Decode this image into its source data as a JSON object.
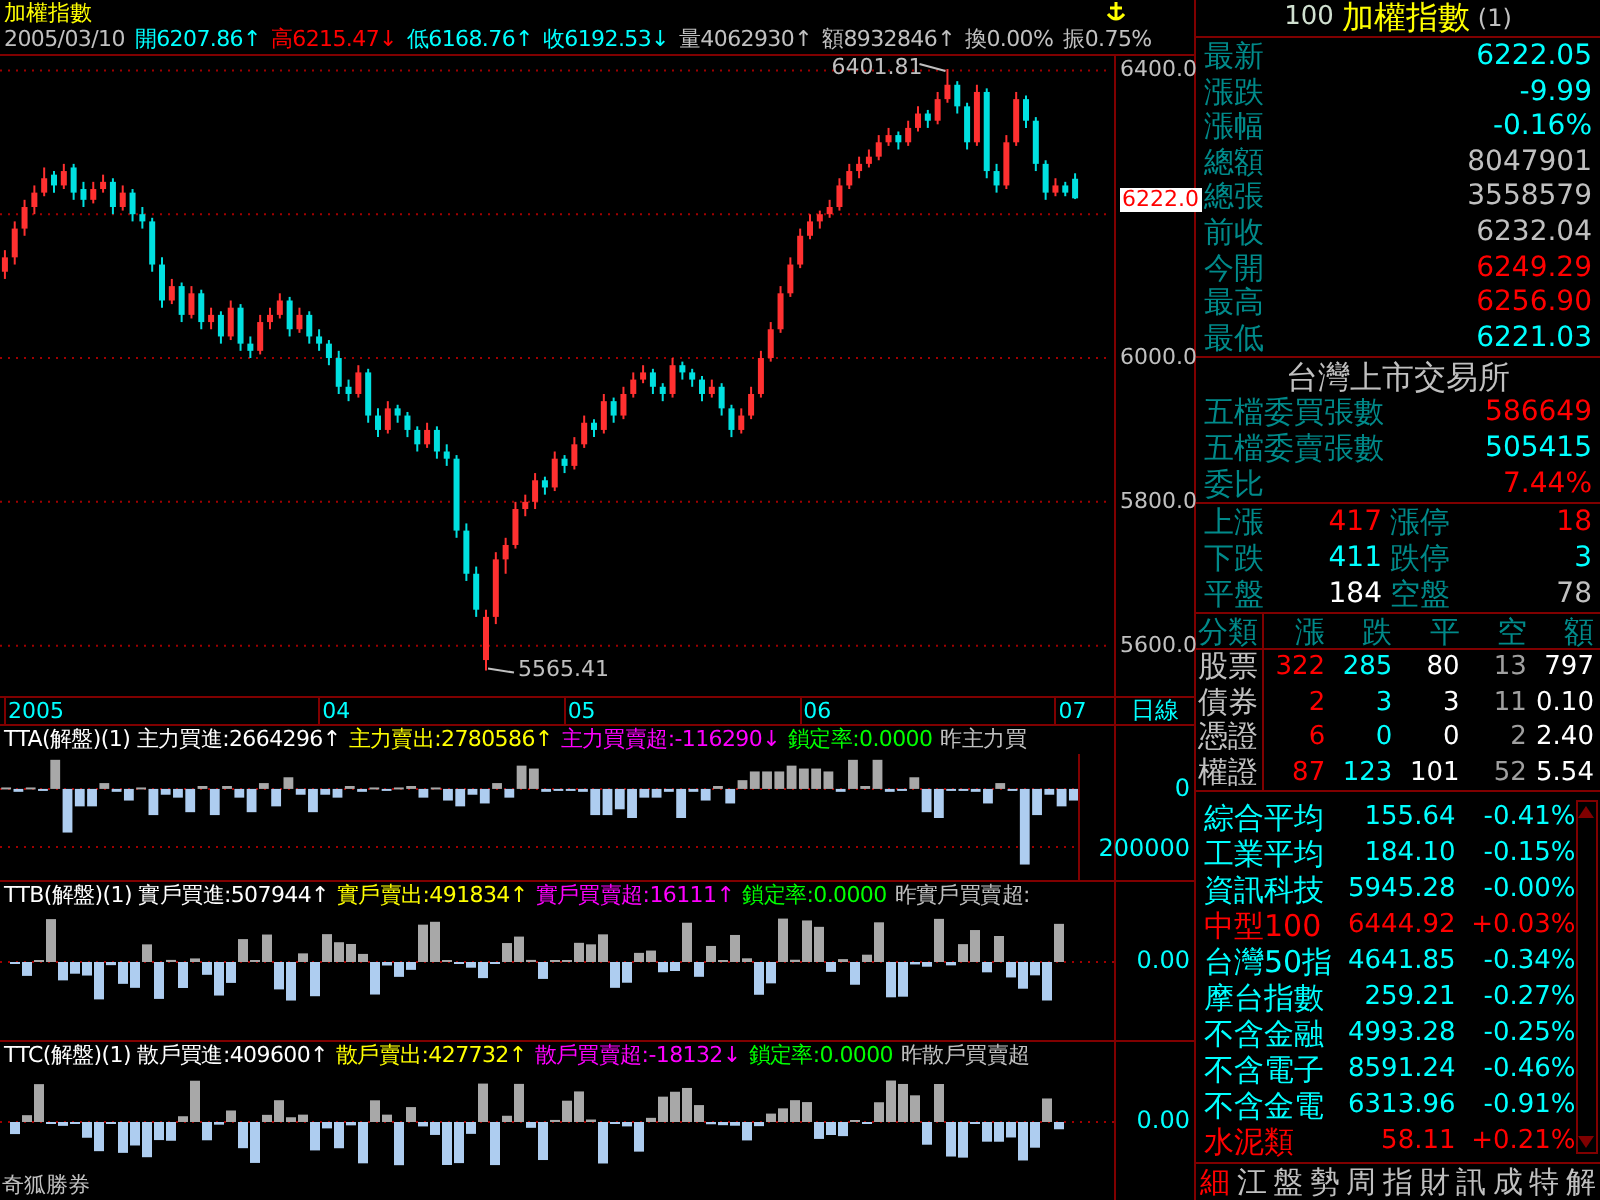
{
  "chart_title": "加權指數",
  "info_bar": {
    "date": "2005/03/10",
    "items": [
      {
        "label": "開",
        "value": "6207.86",
        "arrow": "↑",
        "color": "#00ffff"
      },
      {
        "label": "高",
        "value": "6215.47",
        "arrow": "↓",
        "color": "#ff0000"
      },
      {
        "label": "低",
        "value": "6168.76",
        "arrow": "↑",
        "color": "#00ffff"
      },
      {
        "label": "收",
        "value": "6192.53",
        "arrow": "↓",
        "color": "#00ffff"
      },
      {
        "label": "量",
        "value": "4062930",
        "arrow": "↑",
        "color": "#c0c0c0"
      },
      {
        "label": "額",
        "value": "8932846",
        "arrow": "↑",
        "color": "#c0c0c0"
      },
      {
        "label": "換",
        "value": "0.00%",
        "color": "#c0c0c0"
      },
      {
        "label": "振",
        "value": "0.75%",
        "color": "#c0c0c0"
      }
    ]
  },
  "price_chart": {
    "chart_data": {
      "type": "candlestick",
      "ohlc": [
        [
          6120,
          6150,
          6110,
          6140
        ],
        [
          6140,
          6190,
          6130,
          6180
        ],
        [
          6180,
          6220,
          6170,
          6210
        ],
        [
          6210,
          6240,
          6200,
          6230
        ],
        [
          6230,
          6265,
          6225,
          6250
        ],
        [
          6255,
          6260,
          6230,
          6240
        ],
        [
          6240,
          6270,
          6235,
          6260
        ],
        [
          6265,
          6270,
          6220,
          6230
        ],
        [
          6235,
          6245,
          6210,
          6220
        ],
        [
          6220,
          6245,
          6215,
          6235
        ],
        [
          6235,
          6255,
          6230,
          6245
        ],
        [
          6245,
          6250,
          6200,
          6210
        ],
        [
          6210,
          6240,
          6205,
          6230
        ],
        [
          6230,
          6235,
          6190,
          6200
        ],
        [
          6200,
          6210,
          6180,
          6190
        ],
        [
          6190,
          6195,
          6120,
          6130
        ],
        [
          6130,
          6140,
          6070,
          6080
        ],
        [
          6080,
          6110,
          6075,
          6100
        ],
        [
          6100,
          6105,
          6050,
          6060
        ],
        [
          6060,
          6100,
          6055,
          6090
        ],
        [
          6090,
          6095,
          6040,
          6050
        ],
        [
          6050,
          6070,
          6040,
          6060
        ],
        [
          6060,
          6065,
          6020,
          6030
        ],
        [
          6030,
          6080,
          6025,
          6070
        ],
        [
          6070,
          6075,
          6010,
          6020
        ],
        [
          6020,
          6030,
          6000,
          6010
        ],
        [
          6010,
          6060,
          6005,
          6050
        ],
        [
          6050,
          6070,
          6040,
          6060
        ],
        [
          6060,
          6090,
          6055,
          6080
        ],
        [
          6080,
          6085,
          6030,
          6040
        ],
        [
          6040,
          6070,
          6035,
          6060
        ],
        [
          6060,
          6065,
          6020,
          6030
        ],
        [
          6030,
          6040,
          6010,
          6020
        ],
        [
          6020,
          6025,
          5990,
          6000
        ],
        [
          6000,
          6010,
          5950,
          5960
        ],
        [
          5960,
          5970,
          5940,
          5950
        ],
        [
          5950,
          5990,
          5945,
          5980
        ],
        [
          5980,
          5985,
          5910,
          5920
        ],
        [
          5920,
          5930,
          5890,
          5900
        ],
        [
          5900,
          5940,
          5895,
          5930
        ],
        [
          5930,
          5935,
          5910,
          5920
        ],
        [
          5920,
          5925,
          5890,
          5900
        ],
        [
          5900,
          5905,
          5870,
          5880
        ],
        [
          5880,
          5910,
          5875,
          5900
        ],
        [
          5900,
          5905,
          5860,
          5870
        ],
        [
          5870,
          5880,
          5850,
          5860
        ],
        [
          5860,
          5865,
          5750,
          5760
        ],
        [
          5760,
          5770,
          5690,
          5700
        ],
        [
          5700,
          5710,
          5640,
          5650
        ],
        [
          5580,
          5650,
          5565.41,
          5640
        ],
        [
          5640,
          5730,
          5630,
          5720
        ],
        [
          5720,
          5750,
          5700,
          5740
        ],
        [
          5740,
          5800,
          5735,
          5790
        ],
        [
          5790,
          5810,
          5780,
          5800
        ],
        [
          5800,
          5840,
          5790,
          5830
        ],
        [
          5830,
          5835,
          5810,
          5820
        ],
        [
          5820,
          5870,
          5815,
          5860
        ],
        [
          5860,
          5865,
          5840,
          5850
        ],
        [
          5850,
          5890,
          5845,
          5880
        ],
        [
          5880,
          5920,
          5875,
          5910
        ],
        [
          5910,
          5915,
          5890,
          5900
        ],
        [
          5900,
          5950,
          5895,
          5940
        ],
        [
          5940,
          5945,
          5910,
          5920
        ],
        [
          5920,
          5960,
          5915,
          5950
        ],
        [
          5950,
          5980,
          5945,
          5970
        ],
        [
          5970,
          5990,
          5965,
          5980
        ],
        [
          5980,
          5985,
          5950,
          5960
        ],
        [
          5960,
          5965,
          5940,
          5950
        ],
        [
          5950,
          6000,
          5945,
          5990
        ],
        [
          5990,
          5995,
          5970,
          5980
        ],
        [
          5980,
          5985,
          5960,
          5970
        ],
        [
          5970,
          5975,
          5940,
          5950
        ],
        [
          5950,
          5970,
          5945,
          5960
        ],
        [
          5960,
          5965,
          5920,
          5930
        ],
        [
          5930,
          5935,
          5890,
          5900
        ],
        [
          5900,
          5930,
          5895,
          5920
        ],
        [
          5920,
          5960,
          5915,
          5950
        ],
        [
          5950,
          6010,
          5945,
          6000
        ],
        [
          6000,
          6050,
          5995,
          6040
        ],
        [
          6040,
          6100,
          6035,
          6090
        ],
        [
          6090,
          6140,
          6085,
          6130
        ],
        [
          6130,
          6180,
          6125,
          6170
        ],
        [
          6170,
          6200,
          6165,
          6190
        ],
        [
          6190,
          6205,
          6180,
          6200
        ],
        [
          6200,
          6220,
          6195,
          6210
        ],
        [
          6210,
          6250,
          6205,
          6240
        ],
        [
          6240,
          6270,
          6235,
          6260
        ],
        [
          6260,
          6280,
          6250,
          6270
        ],
        [
          6270,
          6290,
          6265,
          6280
        ],
        [
          6280,
          6310,
          6275,
          6300
        ],
        [
          6300,
          6320,
          6295,
          6310
        ],
        [
          6310,
          6315,
          6290,
          6300
        ],
        [
          6300,
          6330,
          6295,
          6320
        ],
        [
          6320,
          6350,
          6315,
          6340
        ],
        [
          6340,
          6345,
          6320,
          6330
        ],
        [
          6330,
          6370,
          6325,
          6360
        ],
        [
          6360,
          6401.81,
          6355,
          6380
        ],
        [
          6380,
          6385,
          6340,
          6350
        ],
        [
          6350,
          6355,
          6290,
          6300
        ],
        [
          6300,
          6380,
          6295,
          6370
        ],
        [
          6370,
          6375,
          6250,
          6260
        ],
        [
          6260,
          6270,
          6230,
          6240
        ],
        [
          6240,
          6310,
          6235,
          6300
        ],
        [
          6300,
          6370,
          6295,
          6360
        ],
        [
          6360,
          6365,
          6320,
          6330
        ],
        [
          6330,
          6335,
          6260,
          6270
        ],
        [
          6270,
          6275,
          6220,
          6230
        ],
        [
          6230,
          6250,
          6225,
          6240
        ],
        [
          6240,
          6245,
          6225,
          6230
        ],
        [
          6249.29,
          6256.9,
          6221.03,
          6222.05
        ]
      ],
      "yticks": [
        {
          "value": 6400,
          "label": "6400.0"
        },
        {
          "value": 6000,
          "label": "6000.0"
        },
        {
          "value": 5800,
          "label": "5800.0"
        },
        {
          "value": 5600,
          "label": "5600.0"
        }
      ],
      "ylim": [
        5530,
        6420
      ],
      "grid": true,
      "annotations": [
        "6401.81",
        "5565.41"
      ]
    },
    "x_axis_labels": [
      "2005",
      "04",
      "05",
      "06",
      "07"
    ],
    "last_price_tag": "6222.0",
    "period_tab": "日線"
  },
  "indicators": [
    {
      "segments": [
        {
          "text": "TTA(解盤)(1) 主力買進:2664296↑",
          "color": "#ffffff"
        },
        {
          "text": "主力賣出:2780586↑",
          "color": "#ffff00"
        },
        {
          "text": "主力買賣超:-116290↓",
          "color": "#ff00ff"
        },
        {
          "text": "鎖定率:0.0000",
          "color": "#00ff00"
        },
        {
          "text": "昨主力買",
          "color": "#c0c0c0"
        }
      ],
      "chart_data": {
        "type": "bar",
        "ylim": [
          -320000,
          120000
        ],
        "yticks": [
          {
            "value": 0,
            "label": "0"
          },
          {
            "value": -200000,
            "label": "200000"
          }
        ],
        "values": [
          5000,
          -10000,
          5000,
          -5000,
          100000,
          -150000,
          -60000,
          -60000,
          20000,
          -10000,
          -40000,
          5000,
          -90000,
          -20000,
          -30000,
          -80000,
          10000,
          -90000,
          10000,
          -30000,
          -80000,
          20000,
          -60000,
          40000,
          -20000,
          -80000,
          -20000,
          -30000,
          10000,
          -10000,
          5000,
          -5000,
          5000,
          10000,
          -30000,
          5000,
          -40000,
          -60000,
          -20000,
          -50000,
          20000,
          -30000,
          80000,
          70000,
          -10000,
          -5000,
          -5000,
          -10000,
          -90000,
          -90000,
          -70000,
          -100000,
          -30000,
          -30000,
          -10000,
          -100000,
          -10000,
          -40000,
          10000,
          -50000,
          30000,
          60000,
          60000,
          60000,
          80000,
          70000,
          70000,
          60000,
          -10000,
          100000,
          10000,
          100000,
          -10000,
          -5000,
          40000,
          -80000,
          -100000,
          -5000,
          -5000,
          -10000,
          -50000,
          20000,
          -5000,
          -260000,
          -90000,
          -20000,
          -60000,
          -40000
        ]
      }
    },
    {
      "segments": [
        {
          "text": "TTB(解盤)(1) 實戶買進:507944↑",
          "color": "#ffffff"
        },
        {
          "text": "實戶賣出:491834↑",
          "color": "#ffff00"
        },
        {
          "text": "實戶買賣超:16111↑",
          "color": "#ff00ff"
        },
        {
          "text": "鎖定率:0.0000",
          "color": "#00ff00"
        },
        {
          "text": "昨實戶買賣超:",
          "color": "#c0c0c0"
        }
      ],
      "scale": [
        "0.00"
      ]
    },
    {
      "segments": [
        {
          "text": "TTC(解盤)(1) 散戶買進:409600↑",
          "color": "#ffffff"
        },
        {
          "text": "散戶賣出:427732↑",
          "color": "#ffff00"
        },
        {
          "text": "散戶買賣超:-18132↓",
          "color": "#ff00ff"
        },
        {
          "text": "鎖定率:0.0000",
          "color": "#00ff00"
        },
        {
          "text": "昨散戶買賣超",
          "color": "#c0c0c0"
        }
      ],
      "scale": [
        "0.00"
      ]
    }
  ],
  "brand_label": "奇狐勝券",
  "quote_panel": {
    "code": "100",
    "name": "加權指數",
    "suffix": "(1)",
    "rows": [
      {
        "label": "最新",
        "value": "6222.05",
        "color": "#00ffff"
      },
      {
        "label": "漲跌",
        "value": "-9.99",
        "color": "#00ffff"
      },
      {
        "label": "漲幅",
        "value": "-0.16%",
        "color": "#00ffff"
      },
      {
        "label": "總額",
        "value": "8047901",
        "color": "#c0c0c0"
      },
      {
        "label": "總張",
        "value": "3558579",
        "color": "#c0c0c0"
      },
      {
        "label": "前收",
        "value": "6232.04",
        "color": "#c0c0c0"
      },
      {
        "label": "今開",
        "value": "6249.29",
        "color": "#ff0000"
      },
      {
        "label": "最高",
        "value": "6256.90",
        "color": "#ff0000"
      },
      {
        "label": "最低",
        "value": "6221.03",
        "color": "#00ffff"
      }
    ]
  },
  "exchange_title": "台灣上市交易所",
  "order_rows": [
    {
      "label": "五檔委買張數",
      "value": "586649",
      "color": "#ff0000"
    },
    {
      "label": "五檔委賣張數",
      "value": "505415",
      "color": "#00ffff"
    },
    {
      "label": "委比",
      "value": "7.44%",
      "color": "#ff0000"
    }
  ],
  "breadth": [
    {
      "label": "上漲",
      "value": "417",
      "color": "#ff0000"
    },
    {
      "label": "漲停",
      "value": "18",
      "color": "#ff0000"
    },
    {
      "label": "下跌",
      "value": "411",
      "color": "#00ffff"
    },
    {
      "label": "跌停",
      "value": "3",
      "color": "#00ffff"
    },
    {
      "label": "平盤",
      "value": "184",
      "color": "#ffffff"
    },
    {
      "label": "空盤",
      "value": "78",
      "color": "#c0c0c0"
    }
  ],
  "category_table": {
    "columns": [
      "分類",
      "漲",
      "跌",
      "平",
      "空",
      "額"
    ],
    "rows": [
      {
        "cells": [
          "股票",
          "322",
          "285",
          "80",
          "13",
          "797"
        ]
      },
      {
        "cells": [
          "債券",
          "2",
          "3",
          "3",
          "11",
          "0.10"
        ]
      },
      {
        "cells": [
          "憑證",
          "6",
          "0",
          "0",
          "2",
          "2.40"
        ]
      },
      {
        "cells": [
          "權證",
          "87",
          "123",
          "101",
          "52",
          "5.54"
        ]
      }
    ]
  },
  "index_list": [
    {
      "name": "綜合平均",
      "value": "155.64",
      "change": "-0.41%",
      "color": "#00ffff"
    },
    {
      "name": "工業平均",
      "value": "184.10",
      "change": "-0.15%",
      "color": "#00ffff"
    },
    {
      "name": "資訊科技",
      "value": "5945.28",
      "change": "-0.00%",
      "color": "#00ffff"
    },
    {
      "name": "中型100",
      "value": "6444.92",
      "change": "+0.03%",
      "color": "#ff0000"
    },
    {
      "name": "台灣50指",
      "value": "4641.85",
      "change": "-0.34%",
      "color": "#00ffff"
    },
    {
      "name": "摩台指數",
      "value": "259.21",
      "change": "-0.27%",
      "color": "#00ffff"
    },
    {
      "name": "不含金融",
      "value": "4993.28",
      "change": "-0.25%",
      "color": "#00ffff"
    },
    {
      "name": "不含電子",
      "value": "8591.24",
      "change": "-0.46%",
      "color": "#00ffff"
    },
    {
      "name": "不含金電",
      "value": "6313.96",
      "change": "-0.91%",
      "color": "#00ffff"
    },
    {
      "name": "水泥類",
      "value": "58.11",
      "change": "+0.21%",
      "color": "#ff0000"
    }
  ],
  "bottom_tabs": [
    {
      "label": "細",
      "selected": true
    },
    {
      "label": "江",
      "selected": false
    },
    {
      "label": "盤",
      "selected": false
    },
    {
      "label": "勢",
      "selected": false
    },
    {
      "label": "周",
      "selected": false
    },
    {
      "label": "指",
      "selected": false
    },
    {
      "label": "財",
      "selected": false
    },
    {
      "label": "訊",
      "selected": false
    },
    {
      "label": "成",
      "selected": false
    },
    {
      "label": "特",
      "selected": false
    },
    {
      "label": "解",
      "selected": false
    }
  ]
}
